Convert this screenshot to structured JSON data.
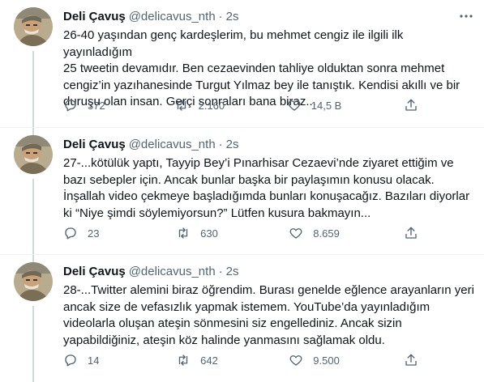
{
  "icons": {
    "more": "more-horizontal-icon",
    "reply": "reply-icon",
    "retweet": "retweet-icon",
    "like": "heart-icon",
    "share": "share-icon"
  },
  "colors": {
    "text": "#0f1419",
    "secondary": "#536471",
    "thread_line": "#cfd9de",
    "divider": "#eff3f4"
  },
  "tweets": [
    {
      "name": "Deli Çavuş",
      "handle": "@delicavus_nth",
      "separator": "·",
      "time": "2s",
      "text": "26-40 yaşından genç kardeşlerim, bu mehmet cengiz ile ilgili ilk yayınladığım\n25 tweetin devamıdır. Ben cezaevinden tahliye olduktan sonra mehmet\ncengiz’in yazıhanesinde Turgut Yılmaz bey ile tanıştık. Kendisi akıllı ve bir\nduruşu olan insan. Gerçi sonraları bana biraz...",
      "replies": "372",
      "retweets": "2.160",
      "likes": "14,5 B"
    },
    {
      "name": "Deli Çavuş",
      "handle": "@delicavus_nth",
      "separator": "·",
      "time": "2s",
      "text": "27-...kötülük yaptı, Tayyip Bey’i Pınarhisar Cezaevi’nde ziyaret ettiğim ve\nbazı sebepler için. Ancak bunlar başka bir paylaşımın konusu olacak.\nİnşallah video çekmeye başladığımda bunları konuşacağız. Bazıları diyorlar\nki “Niye şimdi söylemiyorsun?”  Lütfen kusura bakmayın...",
      "replies": "23",
      "retweets": "630",
      "likes": "8.659"
    },
    {
      "name": "Deli Çavuş",
      "handle": "@delicavus_nth",
      "separator": "·",
      "time": "2s",
      "text": "28-...Twitter alemini biraz öğrendim. Burası genelde eğlence arayanların yeri\nancak size de vefasızlık yapmak istemem. YouTube’da yayınladığım\nvideolarla oluşan ateşin sönmesini siz engellediniz. Ancak sizin\nyapabildiğiniz, ateşin köz halinde yanmasını sağlamak oldu.",
      "replies": "14",
      "retweets": "642",
      "likes": "9.500"
    }
  ]
}
